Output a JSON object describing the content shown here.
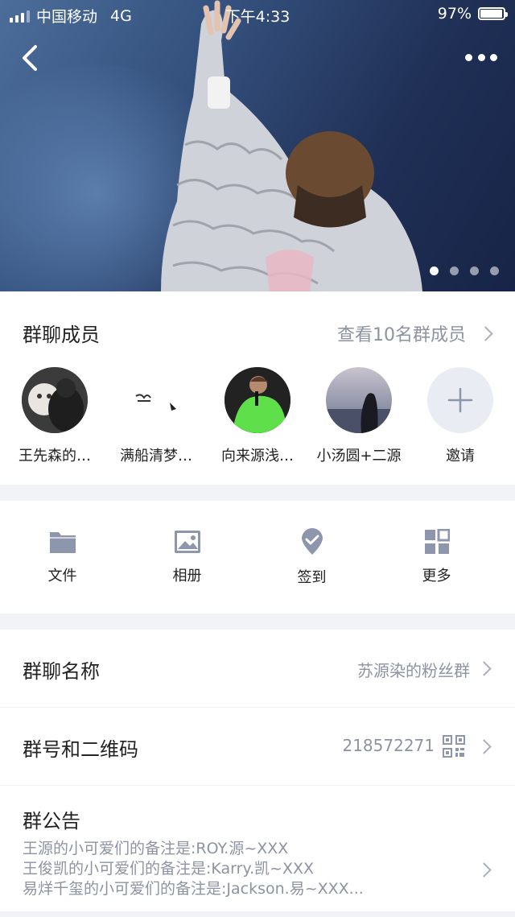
{
  "status_bar": {
    "carrier": "中国移动",
    "network": "4G",
    "time": "下午4:33",
    "battery_percent": "97%",
    "battery_level": 0.97
  },
  "hero": {
    "carousel_pages": 4,
    "active_page": 0
  },
  "members": {
    "title": "群聊成员",
    "view_all": "查看10名群成员",
    "list": [
      {
        "name": "王先森的…"
      },
      {
        "name": "满船清梦…"
      },
      {
        "name": "向来源浅…"
      },
      {
        "name": "小汤圆+二源"
      },
      {
        "name": "邀请"
      }
    ]
  },
  "tools": [
    {
      "label": "文件",
      "icon": "folder-icon"
    },
    {
      "label": "相册",
      "icon": "image-icon"
    },
    {
      "label": "签到",
      "icon": "checkin-icon"
    },
    {
      "label": "更多",
      "icon": "grid-icon"
    }
  ],
  "settings": {
    "group_name_label": "群聊名称",
    "group_name_value": "苏源染的粉丝群",
    "group_id_label": "群号和二维码",
    "group_id_value": "218572271",
    "notice_label": "群公告",
    "notice_lines": [
      "王源的小可爱们的备注是:ROY.源~XXX",
      "王俊凯的小可爱们的备注是:Karry.凯~XXX",
      "易烊千玺的小可爱们的备注是:Jackson.易~XXX..."
    ]
  },
  "colors": {
    "accent_icon": "#8e96ad",
    "divider_bg": "#f2f3f7",
    "secondary_text": "#8d93a1"
  }
}
